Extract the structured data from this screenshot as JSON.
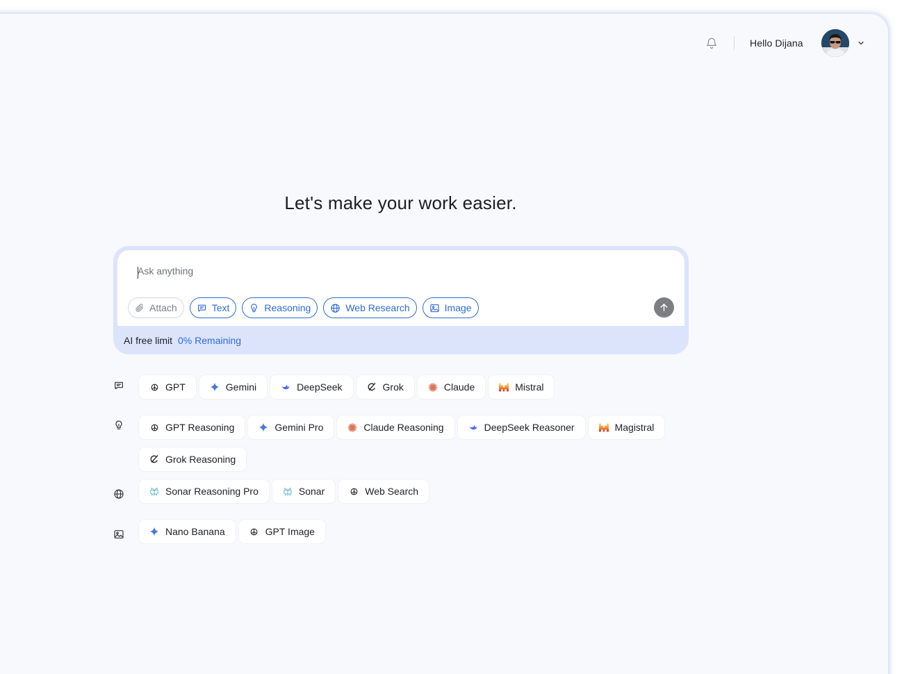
{
  "header": {
    "greeting": "Hello Dijana"
  },
  "headline": "Let's make your work easier.",
  "composer": {
    "placeholder": "Ask anything",
    "chips": [
      {
        "label": "Attach",
        "icon": "paperclip-icon"
      },
      {
        "label": "Text",
        "icon": "chat-icon"
      },
      {
        "label": "Reasoning",
        "icon": "lightbulb-icon"
      },
      {
        "label": "Web Research",
        "icon": "globe-icon"
      },
      {
        "label": "Image",
        "icon": "image-icon"
      }
    ],
    "limit_label": "AI free limit",
    "limit_value": "0% Remaining"
  },
  "model_groups": [
    {
      "icon": "chat-icon",
      "models": [
        "GPT",
        "Gemini",
        "DeepSeek",
        "Grok",
        "Claude",
        "Mistral"
      ]
    },
    {
      "icon": "lightbulb-icon",
      "models": [
        "GPT Reasoning",
        "Gemini Pro",
        "Claude Reasoning",
        "DeepSeek Reasoner",
        "Magistral",
        "Grok Reasoning"
      ]
    },
    {
      "icon": "globe-icon",
      "models": [
        "Sonar Reasoning Pro",
        "Sonar",
        "Web Search"
      ]
    },
    {
      "icon": "image-icon",
      "models": [
        "Nano Banana",
        "GPT Image"
      ]
    }
  ],
  "colors": {
    "accent": "#2f6bd6",
    "panel_bg": "#f8f9fd",
    "composer_border": "#dbe4fb",
    "send_button": "#7c7e82"
  }
}
